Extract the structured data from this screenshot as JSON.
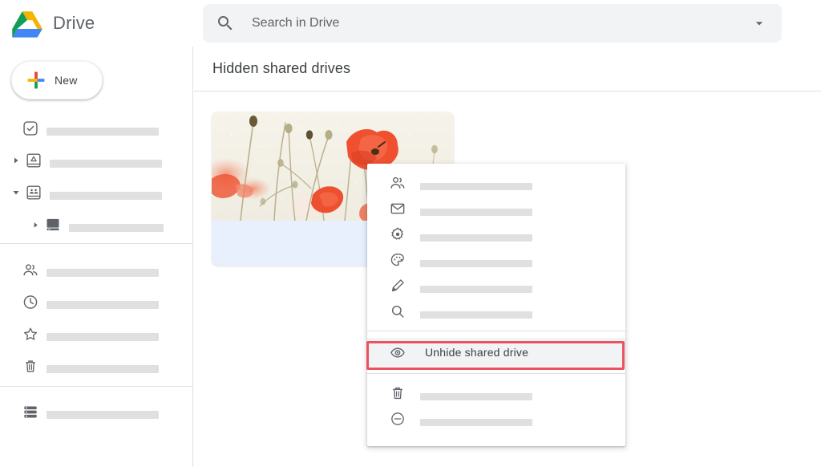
{
  "app": {
    "brand_name": "Drive",
    "logo_icon": "google-drive-logo",
    "colors": {
      "accent_blue": "#1a73e8",
      "selected_blue": "#e8f0fe",
      "highlight_red": "#ea5260",
      "redaction_gray": "#e0e0e0",
      "search_bg": "#f1f3f4",
      "text_primary": "#3c4043",
      "text_secondary": "#5f6368",
      "drive_logo_green": "#0f9d58",
      "drive_logo_yellow": "#f4b400",
      "drive_logo_blue": "#4285f4",
      "plus_red": "#ea4335",
      "banner_cream": "#f3f0e7",
      "poppy_orange": "#ef5130"
    }
  },
  "search": {
    "placeholder": "Search in Drive",
    "value": "",
    "icon": "search-icon",
    "options_icon": "chevron-down-icon"
  },
  "sidebar": {
    "new_button": {
      "label": "New",
      "icon": "plus-icon"
    },
    "groups": [
      {
        "items": [
          {
            "icon": "check-circle-icon",
            "label": "",
            "redacted": true,
            "redact_width": 140,
            "indent": 0,
            "caret": "none"
          },
          {
            "icon": "my-drive-icon",
            "label": "",
            "redacted": true,
            "redact_width": 140,
            "indent": 0,
            "caret": "collapsed"
          },
          {
            "icon": "shared-drives-icon",
            "label": "",
            "redacted": true,
            "redact_width": 140,
            "indent": 0,
            "caret": "expanded"
          },
          {
            "icon": "hard-drive-icon",
            "label": "",
            "redacted": true,
            "redact_width": 118,
            "indent": 1,
            "caret": "collapsed"
          }
        ]
      },
      {
        "items": [
          {
            "icon": "people-icon",
            "label": "",
            "redacted": true,
            "redact_width": 140,
            "indent": 0,
            "caret": "none"
          },
          {
            "icon": "clock-icon",
            "label": "",
            "redacted": true,
            "redact_width": 140,
            "indent": 0,
            "caret": "none"
          },
          {
            "icon": "star-icon",
            "label": "",
            "redacted": true,
            "redact_width": 140,
            "indent": 0,
            "caret": "none"
          },
          {
            "icon": "trash-icon",
            "label": "",
            "redacted": true,
            "redact_width": 140,
            "indent": 0,
            "caret": "none"
          }
        ]
      },
      {
        "items": [
          {
            "icon": "storage-icon",
            "label": "",
            "redacted": true,
            "redact_width": 140,
            "indent": 0,
            "caret": "none"
          }
        ]
      }
    ]
  },
  "main": {
    "page_title": "Hidden shared drives",
    "drive_card": {
      "banner_image": "poppy-flowers-photo",
      "selected": true,
      "title": ""
    }
  },
  "context_menu": {
    "sections": [
      {
        "items": [
          {
            "icon": "manage-members-icon",
            "label": "",
            "redacted": true,
            "redact_width": 140
          },
          {
            "icon": "email-icon",
            "label": "",
            "redacted": true,
            "redact_width": 140
          },
          {
            "icon": "settings-gear-icon",
            "label": "",
            "redacted": true,
            "redact_width": 140
          },
          {
            "icon": "palette-icon",
            "label": "",
            "redacted": true,
            "redact_width": 140
          },
          {
            "icon": "pencil-icon",
            "label": "",
            "redacted": true,
            "redact_width": 140
          },
          {
            "icon": "search-icon",
            "label": "",
            "redacted": true,
            "redact_width": 140
          }
        ]
      },
      {
        "items": [
          {
            "icon": "eye-icon",
            "label": "Unhide shared drive",
            "redacted": false,
            "highlighted": true
          }
        ]
      },
      {
        "items": [
          {
            "icon": "trash-icon",
            "label": "",
            "redacted": true,
            "redact_width": 140
          },
          {
            "icon": "remove-circle-icon",
            "label": "",
            "redacted": true,
            "redact_width": 140
          }
        ]
      }
    ]
  }
}
